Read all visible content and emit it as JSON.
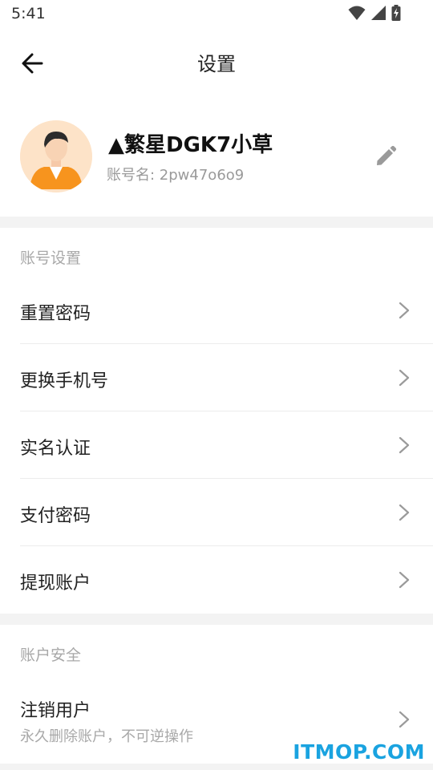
{
  "status_bar": {
    "time": "5:41"
  },
  "header": {
    "title": "设置"
  },
  "profile": {
    "nickname": "▲繁星DGK7小草",
    "account_prefix": "账号名: ",
    "account_name": "2pw47o6o9"
  },
  "sections": [
    {
      "title": "账号设置",
      "items": [
        {
          "label": "重置密码"
        },
        {
          "label": "更换手机号"
        },
        {
          "label": "实名认证"
        },
        {
          "label": "支付密码"
        },
        {
          "label": "提现账户"
        }
      ]
    },
    {
      "title": "账户安全",
      "items": [
        {
          "label": "注销用户",
          "sublabel": "永久删除账户，不可逆操作"
        }
      ]
    }
  ],
  "watermark": "ITMOP.COM",
  "colors": {
    "accent_watermark": "#1aa3e0",
    "avatar_bg": "#fde3c8",
    "avatar_shirt": "#f7941e",
    "separator_band": "#f3f3f3"
  },
  "icons": [
    "wifi-icon",
    "signal-icon",
    "battery-icon",
    "back-arrow-icon",
    "avatar",
    "edit-pencil-icon",
    "chevron-right-icon"
  ]
}
